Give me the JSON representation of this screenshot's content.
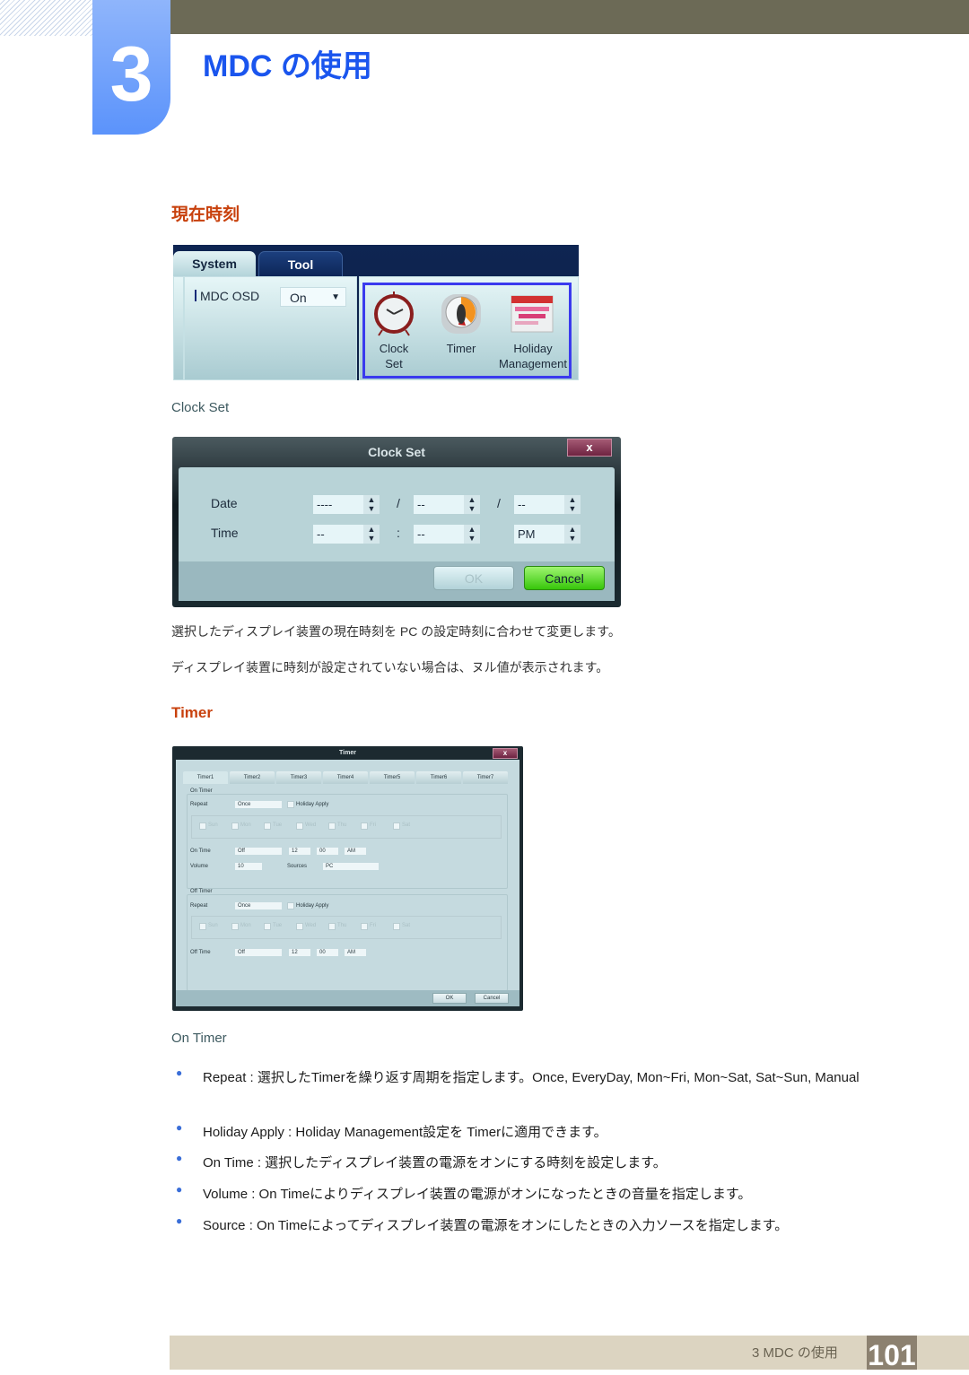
{
  "chapter": {
    "number": "3",
    "title": "MDC の使用"
  },
  "section_current_time": {
    "heading": "現在時刻",
    "screenshot": {
      "tabs": [
        "System",
        "Tool"
      ],
      "osd_label": "MDC OSD",
      "osd_value": "On",
      "tools": [
        {
          "icon": "alarm-clock-icon",
          "label_line1": "Clock",
          "label_line2": "Set"
        },
        {
          "icon": "kitchen-timer-icon",
          "label_line1": "Timer",
          "label_line2": ""
        },
        {
          "icon": "calendar-icon",
          "label_line1": "Holiday",
          "label_line2": "Management"
        }
      ]
    },
    "subheading": "Clock Set",
    "clock_dialog": {
      "title": "Clock Set",
      "close": "x",
      "date_label": "Date",
      "time_label": "Time",
      "date_year": "----",
      "date_month": "--",
      "date_day": "--",
      "date_sep": "/",
      "time_hour": "--",
      "time_minute": "--",
      "time_sep": ":",
      "time_ampm": "PM",
      "ok": "OK",
      "cancel": "Cancel"
    },
    "paragraphs": [
      "選択したディスプレイ装置の現在時刻を PC の設定時刻に合わせて変更します。",
      "ディスプレイ装置に時刻が設定されていない場合は、ヌル値が表示されます。"
    ]
  },
  "section_timer": {
    "heading": "Timer",
    "timer_dialog": {
      "title": "Timer",
      "close": "x",
      "tabs": [
        "Timer1",
        "Timer2",
        "Timer3",
        "Timer4",
        "Timer5",
        "Timer6",
        "Timer7"
      ],
      "on_timer": {
        "group_label": "On Timer",
        "repeat_label": "Repeat",
        "repeat_value": "Once",
        "holiday_apply": "Holiday Apply",
        "days": [
          "Sun",
          "Mon",
          "Tue",
          "Wed",
          "Thu",
          "Fri",
          "Sat"
        ],
        "on_time_label": "On Time",
        "on_time_value": "Off",
        "hour": "12",
        "minute": "00",
        "ampm": "AM",
        "volume_label": "Volume",
        "volume_value": "10",
        "sources_label": "Sources",
        "sources_value": "PC"
      },
      "off_timer": {
        "group_label": "Off Timer",
        "repeat_label": "Repeat",
        "repeat_value": "Once",
        "holiday_apply": "Holiday Apply",
        "days": [
          "Sun",
          "Mon",
          "Tue",
          "Wed",
          "Thu",
          "Fri",
          "Sat"
        ],
        "off_time_label": "Off Time",
        "off_time_value": "Off",
        "hour": "12",
        "minute": "00",
        "ampm": "AM"
      },
      "ok": "OK",
      "cancel": "Cancel"
    },
    "subheading": "On Timer",
    "bullets": [
      "Repeat : 選択したTimerを繰り返す周期を指定します。Once, EveryDay, Mon~Fri, Mon~Sat, Sat~Sun, Manual",
      "Holiday Apply : Holiday Management設定を Timerに適用できます。",
      "On Time : 選択したディスプレイ装置の電源をオンにする時刻を設定します。",
      "Volume : On Timeによりディスプレイ装置の電源がオンになったときの音量を指定します。",
      "Source : On Timeによってディスプレイ装置の電源をオンにしたときの入力ソースを指定します。"
    ]
  },
  "footer": {
    "text": "3 MDC の使用",
    "page": "101"
  }
}
